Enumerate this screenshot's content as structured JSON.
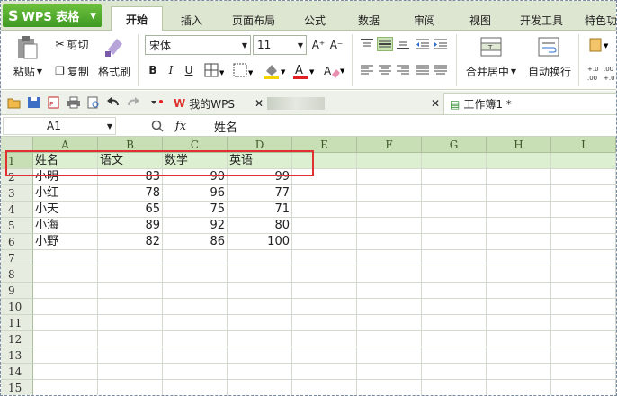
{
  "app": {
    "name": "WPS 表格",
    "logo_glyph": "S",
    "brand_color": "#4aa52a"
  },
  "ribbon_tabs": [
    {
      "label": "开始",
      "active": true
    },
    {
      "label": "插入"
    },
    {
      "label": "页面布局"
    },
    {
      "label": "公式"
    },
    {
      "label": "数据"
    },
    {
      "label": "审阅"
    },
    {
      "label": "视图"
    },
    {
      "label": "开发工具"
    },
    {
      "label": "特色功"
    }
  ],
  "ribbon": {
    "paste": "粘贴",
    "cut": "剪切",
    "copy": "复制",
    "format_painter": "格式刷",
    "font_name": "宋体",
    "font_size": "11",
    "bold": "B",
    "italic": "I",
    "underline": "U",
    "merge_center": "合并居中",
    "wrap_text": "自动换行",
    "font_grow": "A⁺",
    "font_shrink": "A⁻"
  },
  "doc_tabs": [
    {
      "label": "我的WPS"
    },
    {
      "label": "工作簿1 *",
      "active": true
    }
  ],
  "formula_bar": {
    "cell_ref": "A1",
    "fx": "fx",
    "value": "姓名"
  },
  "sheet": {
    "columns": [
      "A",
      "B",
      "C",
      "D",
      "E",
      "F",
      "G",
      "H",
      "I"
    ],
    "row_numbers": [
      "1",
      "2",
      "3",
      "4",
      "5",
      "6",
      "7",
      "8",
      "9",
      "10",
      "11",
      "12",
      "13",
      "14",
      "15"
    ],
    "header_row": [
      "姓名",
      "语文",
      "数学",
      "英语"
    ],
    "rows": [
      [
        "小明",
        "83",
        "90",
        "99"
      ],
      [
        "小红",
        "78",
        "96",
        "77"
      ],
      [
        "小天",
        "65",
        "75",
        "71"
      ],
      [
        "小海",
        "89",
        "92",
        "80"
      ],
      [
        "小野",
        "82",
        "86",
        "100"
      ]
    ]
  },
  "colors": {
    "highlight_box": "#e03030",
    "header_fill": "#c8deb4",
    "selected_row_fill": "#dcefd0"
  }
}
